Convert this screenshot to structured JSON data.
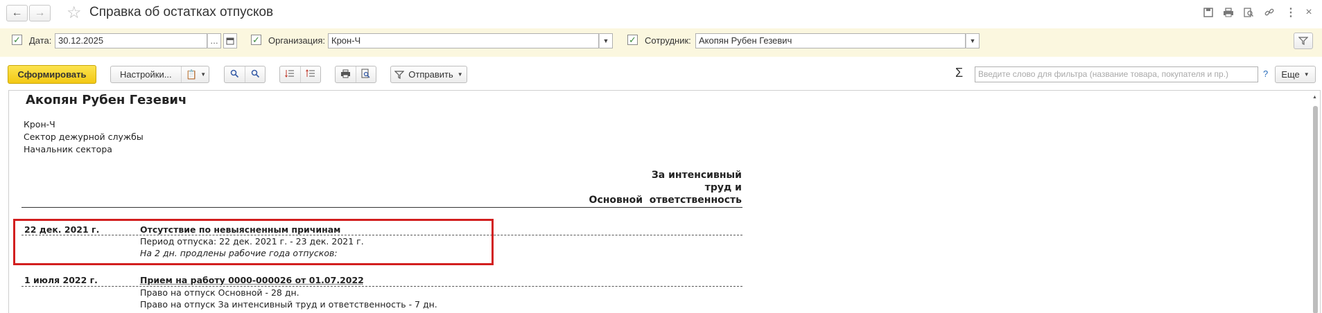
{
  "window": {
    "title": "Справка об остатках отпусков"
  },
  "filters": {
    "date_label": "Дата:",
    "date_value": "30.12.2025",
    "org_label": "Организация:",
    "org_value": "Крон-Ч",
    "employee_label": "Сотрудник:",
    "employee_value": "Акопян Рубен Гезевич"
  },
  "toolbar": {
    "generate": "Сформировать",
    "settings": "Настройки...",
    "send": "Отправить",
    "search_placeholder": "Введите слово для фильтра (название товара, покупателя и пр.)",
    "help": "?",
    "more": "Еще",
    "sigma": "Σ"
  },
  "report": {
    "employee_name": "Акопян Рубен Гезевич",
    "org": "Крон-Ч",
    "department": "Сектор дежурной службы",
    "position": "Начальник сектора",
    "col_main": "Основной",
    "col_intensive_1": "За интенсивный",
    "col_intensive_2": "труд и",
    "col_intensive_3": "ответственность",
    "entries": [
      {
        "date": "22 дек. 2021 г.",
        "title": "Отсутствие по невыясненным причинам",
        "line1": "Период отпуска: 22 дек. 2021 г. - 23 дек. 2021 г.",
        "line2": "На 2 дн. продлены рабочие года отпусков:"
      },
      {
        "date": "1 июля 2022 г.",
        "title": "Прием на работу 0000-000026 от 01.07.2022",
        "line1": "Право на отпуск Основной - 28 дн.",
        "line2": "Право на отпуск За интенсивный труд и ответственность - 7 дн."
      }
    ]
  },
  "colors": {
    "highlight_border": "#d21f1f",
    "filter_bg": "#fbf7df",
    "primary_button": "#f6d21e"
  }
}
